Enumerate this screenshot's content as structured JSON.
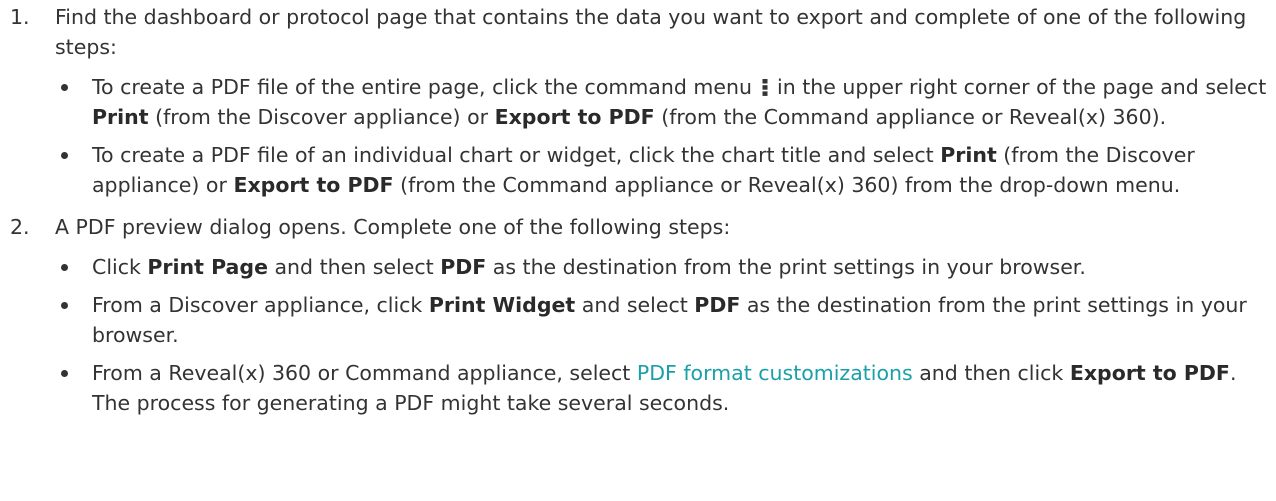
{
  "steps": [
    {
      "number": "1.",
      "text": "Find the dashboard or protocol page that contains the data you want to export and complete of one of the following steps:",
      "bullets": [
        {
          "a": "To create a PDF file of the entire page, click the command menu",
          "icon": "vertical-ellipsis-icon",
          "b": "in the upper right corner of the page and select",
          "bold1": "Print",
          "c": "(from the Discover appliance) or",
          "bold2": "Export to PDF",
          "d": "(from the Command appliance or Reveal(x) 360)."
        },
        {
          "a": "To create a PDF file of an individual chart or widget, click the chart title and select",
          "bold1": "Print",
          "b": "(from the Discover appliance) or",
          "bold2": "Export to PDF",
          "c": "(from the Command appliance or Reveal(x) 360) from the drop-down menu."
        }
      ]
    },
    {
      "number": "2.",
      "text": "A PDF preview dialog opens. Complete one of the following steps:",
      "bullets": [
        {
          "a": "Click",
          "bold1": "Print Page",
          "b": "and then select",
          "bold2": "PDF",
          "c": "as the destination from the print settings in your browser."
        },
        {
          "a": "From a Discover appliance, click",
          "bold1": "Print Widget",
          "b": "and select",
          "bold2": "PDF",
          "c": "as the destination from the print settings in your browser."
        },
        {
          "a": "From a Reveal(x) 360 or Command appliance, select",
          "link": "PDF format customizations",
          "b": "and then click",
          "bold1": "Export to PDF",
          "c": ". The process for generating a PDF might take several seconds."
        }
      ]
    }
  ],
  "colors": {
    "text": "#333333",
    "link": "#1aa0a8"
  }
}
